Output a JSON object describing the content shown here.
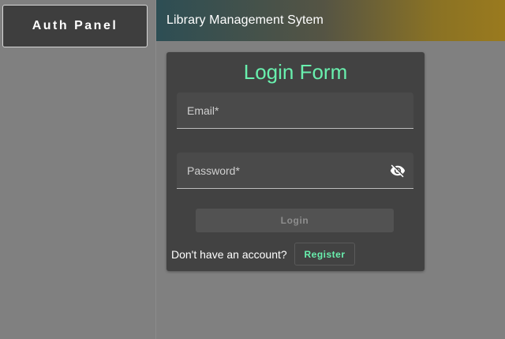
{
  "sidebar": {
    "panel_label": "Auth Panel"
  },
  "header": {
    "title": "Library Management Sytem"
  },
  "login_form": {
    "title": "Login Form",
    "email": {
      "label": "Email*",
      "value": ""
    },
    "password": {
      "label": "Password*",
      "value": "",
      "toggle_icon": "visibility-off-icon"
    },
    "login_label": "Login",
    "no_account_text": "Don't have an account?",
    "register_label": "Register"
  },
  "colors": {
    "accent": "#69f0ae",
    "card": "#424242",
    "background": "#808080"
  }
}
